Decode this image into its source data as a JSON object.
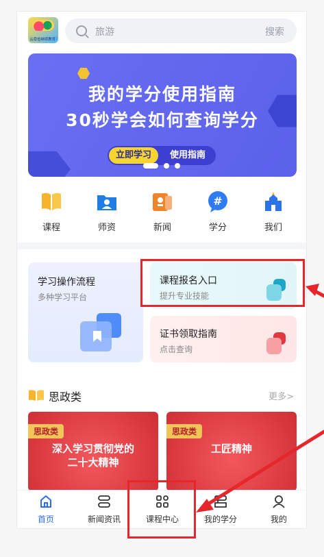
{
  "header": {
    "logo_text": "云南省继续教育平台",
    "search_placeholder": "旅游",
    "search_button": "搜索"
  },
  "banner": {
    "line1": "我的学分使用指南",
    "line2": "30秒学会如何查询学分",
    "btn_learn": "立即学习",
    "btn_guide": "使用指南"
  },
  "icons": [
    {
      "label": "课程",
      "icon": "book-icon",
      "color": "#f6b42a"
    },
    {
      "label": "师资",
      "icon": "teacher-folder-icon",
      "color": "#1e7ee6"
    },
    {
      "label": "新闻",
      "icon": "news-icon",
      "color": "#f0842a"
    },
    {
      "label": "学分",
      "icon": "hash-chat-icon",
      "color": "#2f7cf2"
    },
    {
      "label": "我们",
      "icon": "building-icon",
      "color": "#2c73e8"
    }
  ],
  "cards": {
    "left": {
      "title": "学习操作流程",
      "sub": "多种学习平台"
    },
    "right_top": {
      "title": "课程报名入口",
      "sub": "提升专业技能"
    },
    "right_bottom": {
      "title": "证书领取指南",
      "sub": "点击查询"
    }
  },
  "section": {
    "title": "思政类",
    "more": "更多>"
  },
  "courses": [
    {
      "tag": "思政类",
      "line1": "深入学习贯彻党的",
      "line2": "二十大精神"
    },
    {
      "tag": "思政类",
      "line1": "工匠精神",
      "line2": ""
    }
  ],
  "nav": [
    {
      "label": "首页",
      "icon": "home-icon",
      "active": true
    },
    {
      "label": "新闻资讯",
      "icon": "news-stack-icon",
      "active": false
    },
    {
      "label": "课程中心",
      "icon": "grid-icon",
      "active": false
    },
    {
      "label": "我的学分",
      "icon": "credit-stack-icon",
      "active": false
    },
    {
      "label": "我的",
      "icon": "user-icon",
      "active": false
    }
  ],
  "colors": {
    "accent": "#2b6cf5",
    "banner": "#5f65ee",
    "highlight": "#e5262b"
  }
}
